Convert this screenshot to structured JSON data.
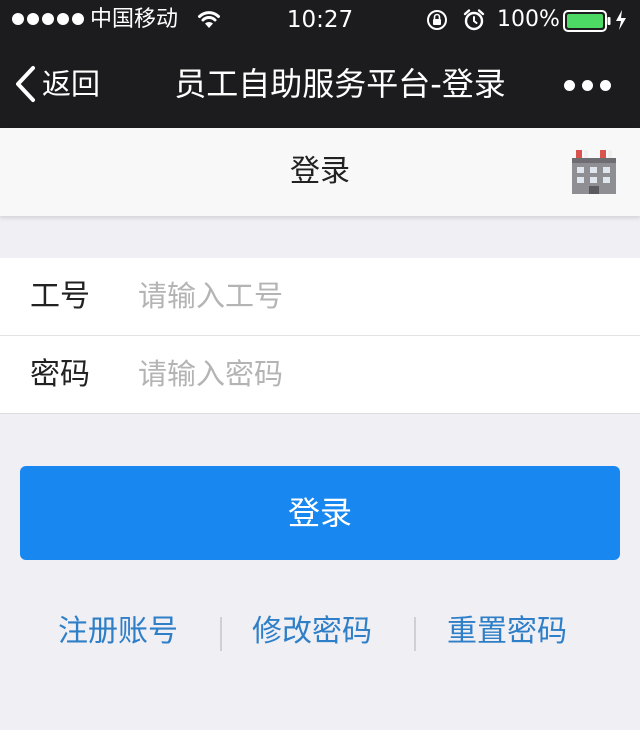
{
  "status_bar": {
    "carrier": "中国移动",
    "time": "10:27",
    "battery": "100%",
    "icons": [
      "signal-dots-icon",
      "wifi-icon",
      "orientation-lock-icon",
      "alarm-icon",
      "battery-icon",
      "charging-bolt-icon"
    ]
  },
  "nav": {
    "back_label": "返回",
    "title": "员工自助服务平台-登录",
    "more_icon": "more-dots-icon"
  },
  "header": {
    "title": "登录",
    "icon": "building-icon"
  },
  "form": {
    "employee_id": {
      "label": "工号",
      "placeholder": "请输入工号",
      "value": ""
    },
    "password": {
      "label": "密码",
      "placeholder": "请输入密码",
      "value": ""
    }
  },
  "login_button": "登录",
  "links": {
    "register": "注册账号",
    "change_password": "修改密码",
    "reset_password": "重置密码"
  },
  "colors": {
    "top_bar": "#1c1c1e",
    "primary_button": "#1887f0",
    "link": "#2f7fc8",
    "background": "#efeff4"
  }
}
